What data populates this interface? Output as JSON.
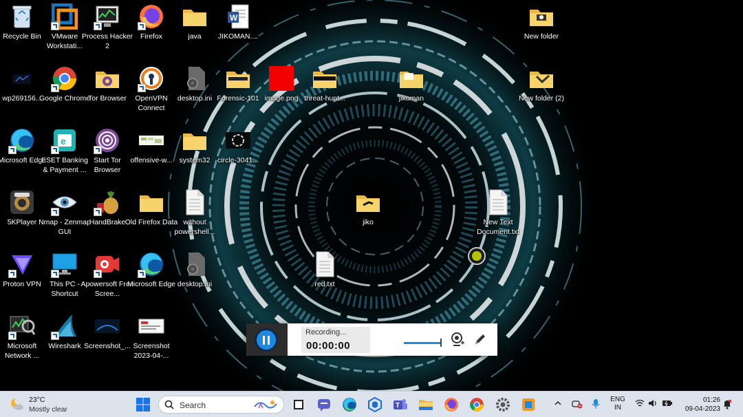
{
  "desktop": {
    "icons": [
      {
        "label": "Recycle Bin",
        "icon": "recycle-bin-icon"
      },
      {
        "label": "VMware Workstati...",
        "icon": "vmware-icon"
      },
      {
        "label": "Process Hacker 2",
        "icon": "process-hacker-icon"
      },
      {
        "label": "Firefox",
        "icon": "firefox-icon"
      },
      {
        "label": "java",
        "icon": "folder-icon"
      },
      {
        "label": "JIKOMAN....",
        "icon": "word-document-icon"
      },
      {
        "label": "New folder",
        "icon": "folder-icon"
      },
      {
        "label": "wp269156...",
        "icon": "image-file-icon"
      },
      {
        "label": "Google Chrome",
        "icon": "chrome-icon"
      },
      {
        "label": "Tor Browser",
        "icon": "tor-folder-icon"
      },
      {
        "label": "OpenVPN Connect",
        "icon": "openvpn-icon"
      },
      {
        "label": "desktop.ini",
        "icon": "settings-file-icon"
      },
      {
        "label": "Forensic-101",
        "icon": "folder-icon"
      },
      {
        "label": "image.png",
        "icon": "image-file-icon"
      },
      {
        "label": "threat-hunt...",
        "icon": "folder-icon"
      },
      {
        "label": "jikoman",
        "icon": "folder-icon"
      },
      {
        "label": "New folder (2)",
        "icon": "folder-icon"
      },
      {
        "label": "Microsoft Edge",
        "icon": "edge-icon"
      },
      {
        "label": "ESET Banking & Payment ...",
        "icon": "eset-icon"
      },
      {
        "label": "Start Tor Browser",
        "icon": "tor-browser-icon"
      },
      {
        "label": "offensive-w...",
        "icon": "image-file-icon"
      },
      {
        "label": "system32",
        "icon": "folder-icon"
      },
      {
        "label": "circle-3041...",
        "icon": "image-file-icon"
      },
      {
        "label": "5KPlayer",
        "icon": "5kplayer-icon"
      },
      {
        "label": "Nmap - Zenmap GUI",
        "icon": "nmap-eye-icon"
      },
      {
        "label": "HandBrake",
        "icon": "handbrake-icon"
      },
      {
        "label": "Old Firefox Data",
        "icon": "folder-icon"
      },
      {
        "label": "without powershell...",
        "icon": "text-file-icon"
      },
      {
        "label": "jiko",
        "icon": "folder-icon"
      },
      {
        "label": "New Text Document.txt",
        "icon": "text-file-icon"
      },
      {
        "label": "Proton VPN",
        "icon": "proton-vpn-icon"
      },
      {
        "label": "This PC - Shortcut",
        "icon": "monitor-icon"
      },
      {
        "label": "Apowersoft Free Scree...",
        "icon": "apowersoft-icon"
      },
      {
        "label": "Microsoft Edge",
        "icon": "edge-icon"
      },
      {
        "label": "desktop.ini",
        "icon": "settings-file-icon"
      },
      {
        "label": "red.txt",
        "icon": "text-file-icon"
      },
      {
        "label": "Microsoft Network ...",
        "icon": "network-monitor-icon"
      },
      {
        "label": "Wireshark",
        "icon": "wireshark-icon"
      },
      {
        "label": "Screenshot_...",
        "icon": "image-file-icon"
      },
      {
        "label": "Screenshot 2023-04-...",
        "icon": "image-file-icon"
      }
    ]
  },
  "recorder": {
    "status": "Recording...",
    "time": "00:00:00",
    "pause_icon": "pause-icon",
    "camera_icon": "webcam-icon",
    "pen_icon": "pen-icon"
  },
  "taskbar": {
    "weather": {
      "temp": "23°C",
      "condition": "Mostly clear",
      "icon": "moon-cloud-icon"
    },
    "search": {
      "label": "Search"
    },
    "apps": [
      "task-view-icon",
      "teams-chat-icon",
      "edge-icon",
      "store-icon",
      "teams-icon",
      "file-explorer-icon",
      "firefox-icon",
      "chrome-icon",
      "settings-icon",
      "apowersoft-icon"
    ],
    "tray": {
      "lang_line1": "ENG",
      "lang_line2": "IN",
      "time": "01:26",
      "date": "09-04-2023"
    }
  }
}
